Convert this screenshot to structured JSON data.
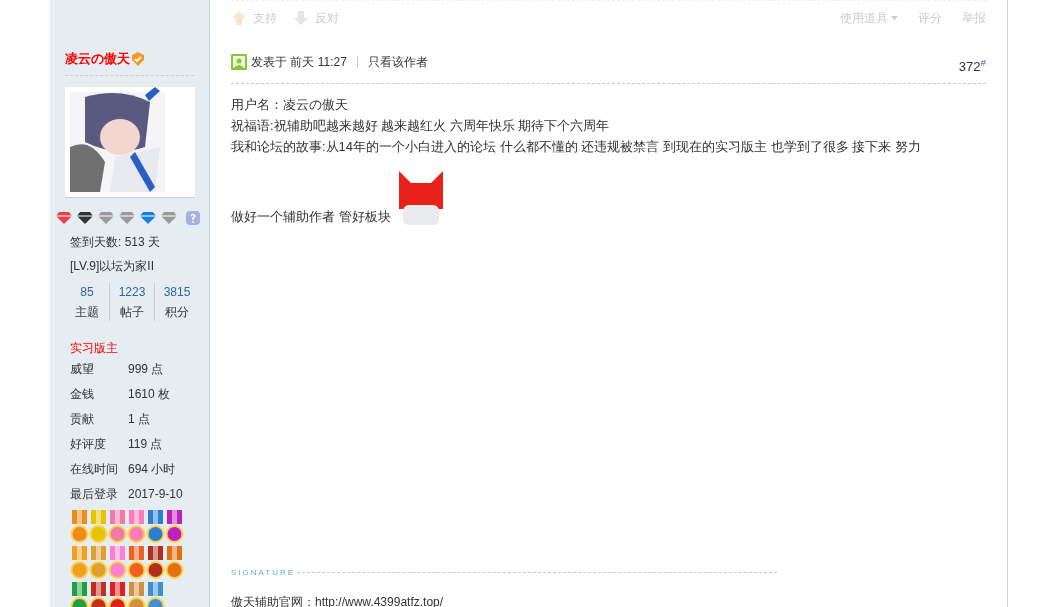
{
  "prev_post": {
    "actions": [
      {
        "kind": "up",
        "label": "支持"
      },
      {
        "kind": "down",
        "label": "反对"
      }
    ],
    "tools": [
      {
        "label": "使用道具",
        "dropdown": true
      },
      {
        "label": "评分",
        "dropdown": false
      },
      {
        "label": "举报",
        "dropdown": false
      }
    ]
  },
  "author": {
    "name": "凌云の傲天",
    "verified": true,
    "gems": [
      {
        "color": "#e8404a"
      },
      {
        "color": "#333333"
      },
      {
        "color": "#9a9a9a"
      },
      {
        "color": "#9a9a9a"
      },
      {
        "color": "#1a7ee0"
      },
      {
        "color": "#9a9a9a"
      }
    ],
    "checkin": "签到天数: 513 天",
    "level": "[LV.9]以坛为家II",
    "stats": [
      {
        "value": "85",
        "label": "主题"
      },
      {
        "value": "1223",
        "label": "帖子"
      },
      {
        "value": "3815",
        "label": "积分"
      }
    ],
    "group": "实习版主",
    "fields": [
      {
        "label": "威望",
        "value": "999 点"
      },
      {
        "label": "金钱",
        "value": "1610 枚"
      },
      {
        "label": "贡献",
        "value": "1 点"
      },
      {
        "label": "好评度",
        "value": "119 点"
      },
      {
        "label": "在线时间",
        "value": "694 小时"
      },
      {
        "label": "最后登录",
        "value": "2017-9-10"
      }
    ],
    "medals": [
      {
        "color": "#f08a1c"
      },
      {
        "color": "#e8c400"
      },
      {
        "color": "#f07aa8"
      },
      {
        "color": "#ff7ab8"
      },
      {
        "color": "#2a7fd0"
      },
      {
        "color": "#c020c0"
      },
      {
        "color": "#f0a020"
      },
      {
        "color": "#e0a030"
      },
      {
        "color": "#ff80d0"
      },
      {
        "color": "#f06020"
      },
      {
        "color": "#b03020"
      },
      {
        "color": "#e07010"
      },
      {
        "color": "#20a040"
      },
      {
        "color": "#c03020"
      },
      {
        "color": "#e02020"
      },
      {
        "color": "#d09040"
      },
      {
        "color": "#4090d0"
      }
    ]
  },
  "post": {
    "posted": "发表于 前天 11:27",
    "author_only": "只看该作者",
    "floor": "372",
    "floor_mark": "#",
    "lines": [
      "用户名：凌云の傲天",
      "祝福语:祝辅助吧越来越好 越来越红火 六周年快乐 期待下个六周年",
      "我和论坛的故事:从14年的一个小白进入的论坛 什么都不懂的 还违规被禁言  到现在的实习版主 也学到了很多  接下来 努力"
    ],
    "last_line": "做好一个辅助作者 管好板块",
    "signature_label": "SIGNATURE",
    "signature_line": "傲天辅助官网：http://www.4399atfz.top/"
  }
}
